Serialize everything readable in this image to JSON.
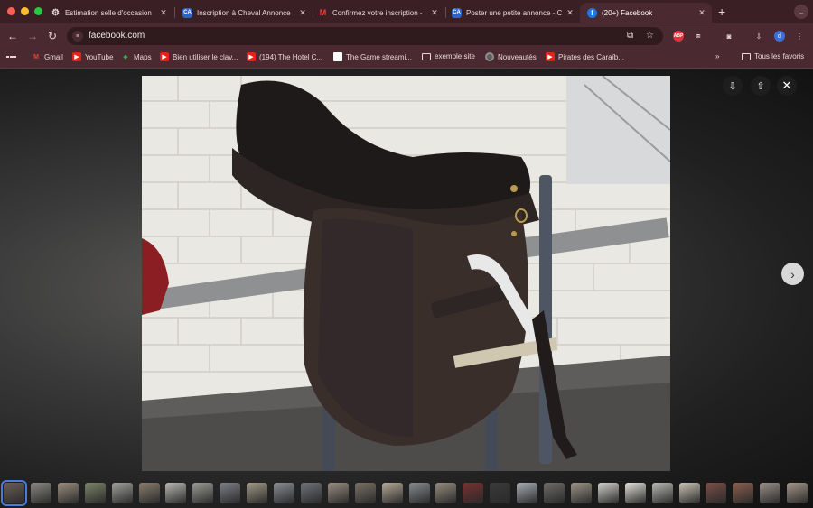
{
  "tabs": [
    {
      "title": "Estimation selle d'occasion",
      "favicon": "ai-chat-icon",
      "active": false
    },
    {
      "title": "Inscription à Cheval Annonce",
      "favicon": "ca-logo-icon",
      "active": false
    },
    {
      "title": "Confirmez votre inscription -",
      "favicon": "gmail-icon",
      "active": false
    },
    {
      "title": "Poster une petite annonce - C",
      "favicon": "ca-logo-icon",
      "active": false
    },
    {
      "title": "(20+) Facebook",
      "favicon": "facebook-icon",
      "active": true
    }
  ],
  "omnibox": {
    "url": "facebook.com"
  },
  "bookmarks": [
    {
      "label": "Gmail",
      "icon": "gmail-icon"
    },
    {
      "label": "YouTube",
      "icon": "youtube-icon"
    },
    {
      "label": "Maps",
      "icon": "maps-icon"
    },
    {
      "label": "Bien utiliser le clav...",
      "icon": "youtube-icon"
    },
    {
      "label": "(194) The Hotel C...",
      "icon": "youtube-icon"
    },
    {
      "label": "The Game streami...",
      "icon": "page-icon"
    },
    {
      "label": "exemple site",
      "icon": "folder-icon"
    },
    {
      "label": "Nouveautés",
      "icon": "globe-icon"
    },
    {
      "label": "Pirates des Caraïb...",
      "icon": "youtube-icon"
    }
  ],
  "bookmarks_other": "Tous les favoris",
  "profile_initial": "d",
  "abp_label": "ABP",
  "colors": {
    "tab_bar": "#3a1f24",
    "toolbar": "#4a2a30",
    "selected_thumb": "#4a7bdc"
  },
  "thumbnail_count": 30
}
